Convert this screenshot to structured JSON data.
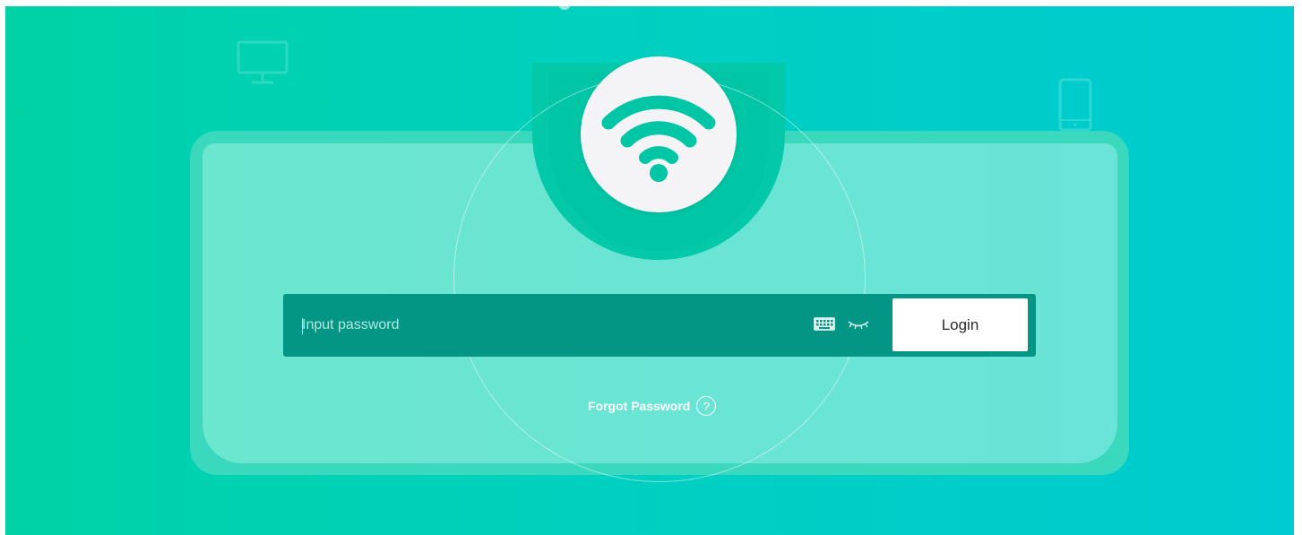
{
  "login": {
    "password_placeholder": "Input password",
    "password_value": "",
    "login_label": "Login",
    "forgot_label": "Forgot Password",
    "help_glyph": "?"
  },
  "icons": {
    "badge": "wifi-icon",
    "keyboard": "keyboard-icon",
    "visibility": "eye-closed-icon",
    "help": "question-circle-icon",
    "decor_left": "monitor-icon",
    "decor_right": "phone-icon"
  },
  "colors": {
    "background_start": "#00d2a6",
    "background_end": "#00cbd0",
    "card": "#6be6cf",
    "input_bar": "#039685",
    "wifi_mark": "#00c6a5",
    "button": "#ffffff"
  }
}
